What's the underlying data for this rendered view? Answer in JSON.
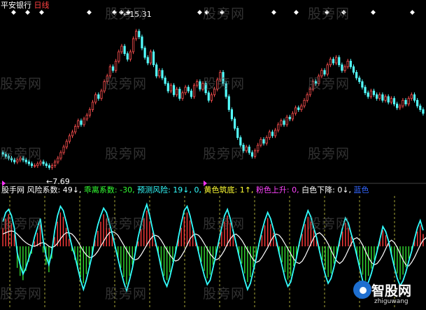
{
  "header": {
    "stock_name": "平安银行",
    "period": "日线",
    "colors": {
      "stock_name": "#ffffff",
      "period": "#ff4040"
    }
  },
  "price_panel": {
    "high_label": "15.31",
    "low_label": "7.69",
    "marker_symbol": "◆"
  },
  "indicator_row": {
    "items": [
      {
        "text": "股手网",
        "color": "#ffffff"
      },
      {
        "text": "风险系数: 49↓,",
        "color": "#ffffff"
      },
      {
        "text": "乖离系数: -30,",
        "color": "#33ff33"
      },
      {
        "text": "预测风险: 19↓, 0,",
        "color": "#33ffff"
      },
      {
        "text": "黄色筑底: 1↑,",
        "color": "#ffff33"
      },
      {
        "text": "粉色上升: 0,",
        "color": "#ff44ff"
      },
      {
        "text": "白色下降: 0↓,",
        "color": "#ffffff"
      },
      {
        "text": "蓝色",
        "color": "#3366ff"
      }
    ]
  },
  "watermark": {
    "text": "股旁网"
  },
  "logo": {
    "name": "智股网",
    "url": "zhiguwang"
  },
  "chart_data": [
    {
      "type": "candlestick",
      "title": "平安银行 日线",
      "ylim": [
        7.0,
        16.0
      ],
      "annotations": {
        "high": 15.31,
        "low": 7.69
      },
      "close": [
        8.4,
        8.3,
        8.2,
        8.1,
        8.0,
        8.1,
        8.2,
        8.1,
        8.0,
        7.9,
        7.8,
        7.8,
        7.9,
        8.0,
        7.9,
        7.8,
        7.7,
        7.8,
        8.0,
        8.2,
        8.5,
        8.8,
        9.1,
        9.4,
        9.6,
        9.9,
        10.2,
        10.0,
        10.3,
        10.5,
        10.8,
        11.2,
        11.6,
        11.4,
        11.8,
        12.3,
        12.6,
        13.1,
        12.9,
        13.4,
        13.9,
        14.2,
        13.8,
        13.5,
        13.9,
        14.6,
        15.0,
        14.7,
        14.1,
        13.6,
        13.3,
        13.9,
        13.2,
        12.6,
        12.9,
        12.5,
        12.2,
        11.8,
        12.1,
        11.6,
        11.9,
        11.4,
        11.7,
        12.0,
        11.8,
        11.5,
        12.1,
        12.3,
        11.9,
        12.2,
        11.7,
        11.3,
        11.6,
        11.9,
        12.4,
        12.8,
        12.2,
        11.5,
        10.8,
        10.3,
        9.8,
        9.3,
        8.9,
        8.6,
        8.8,
        8.5,
        8.3,
        8.6,
        8.9,
        9.2,
        9.0,
        9.3,
        9.6,
        9.4,
        9.7,
        10.0,
        10.2,
        10.0,
        10.4,
        10.3,
        10.6,
        10.9,
        10.8,
        11.0,
        11.3,
        11.6,
        11.9,
        12.3,
        12.2,
        12.6,
        12.9,
        12.7,
        13.2,
        13.5,
        13.3,
        13.6,
        13.2,
        12.9,
        13.1,
        13.4,
        13.1,
        12.8,
        12.5,
        12.3,
        12.0,
        11.7,
        11.5,
        11.8,
        11.6,
        11.4,
        11.6,
        11.3,
        11.5,
        11.2,
        11.4,
        11.1,
        10.9,
        11.0,
        11.3,
        11.1,
        11.4,
        11.6,
        11.3,
        11.0,
        10.8,
        10.6
      ],
      "open": [
        8.5,
        8.4,
        8.3,
        8.2,
        8.1,
        8.0,
        8.1,
        8.2,
        8.1,
        8.0,
        7.9,
        7.8,
        7.8,
        7.9,
        8.0,
        7.9,
        7.8,
        7.7,
        7.8,
        8.0,
        8.2,
        8.5,
        8.8,
        9.1,
        9.4,
        9.6,
        9.9,
        10.2,
        10.0,
        10.3,
        10.5,
        10.8,
        11.2,
        11.6,
        11.4,
        11.8,
        12.3,
        12.6,
        13.1,
        12.9,
        13.4,
        13.9,
        14.2,
        13.8,
        13.5,
        13.9,
        14.6,
        15.0,
        14.7,
        14.1,
        13.6,
        13.3,
        13.9,
        13.2,
        12.6,
        12.9,
        12.5,
        12.2,
        11.8,
        12.1,
        11.6,
        11.9,
        11.4,
        11.7,
        12.0,
        11.8,
        11.5,
        12.1,
        12.3,
        11.9,
        12.2,
        11.7,
        11.3,
        11.6,
        11.9,
        12.4,
        12.8,
        12.2,
        11.5,
        10.8,
        10.3,
        9.8,
        9.3,
        8.9,
        8.6,
        8.8,
        8.5,
        8.3,
        8.6,
        8.9,
        9.2,
        9.0,
        9.3,
        9.6,
        9.4,
        9.7,
        10.0,
        10.2,
        10.0,
        10.4,
        10.3,
        10.6,
        10.9,
        10.8,
        11.0,
        11.3,
        11.6,
        11.9,
        12.3,
        12.2,
        12.6,
        12.9,
        12.7,
        13.2,
        13.5,
        13.3,
        13.6,
        13.2,
        12.9,
        13.1,
        13.4,
        13.1,
        12.8,
        12.5,
        12.3,
        12.0,
        11.7,
        11.5,
        11.8,
        11.6,
        11.4,
        11.6,
        11.3,
        11.5,
        11.2,
        11.4,
        11.1,
        10.9,
        11.0,
        11.3,
        11.1,
        11.4,
        11.6,
        11.3,
        11.0,
        10.8
      ]
    },
    {
      "type": "bar",
      "title": "股手网 风险系数",
      "ylim": [
        -100,
        100
      ],
      "values": [
        30,
        45,
        52,
        38,
        20,
        -35,
        -48,
        -55,
        -40,
        -25,
        -12,
        8,
        22,
        35,
        -10,
        -30,
        -42,
        -20,
        15,
        40,
        55,
        48,
        30,
        12,
        -8,
        -22,
        -38,
        -50,
        -60,
        -45,
        -30,
        -15,
        10,
        25,
        40,
        52,
        45,
        30,
        18,
        -5,
        -20,
        -35,
        -50,
        -62,
        -48,
        -30,
        -12,
        8,
        28,
        45,
        58,
        40,
        22,
        5,
        -15,
        -32,
        -48,
        -55,
        -42,
        -25,
        -10,
        12,
        30,
        48,
        55,
        42,
        26,
        10,
        -8,
        -25,
        -40,
        -52,
        -46,
        -30,
        -14,
        6,
        24,
        40,
        50,
        38,
        20,
        4,
        -12,
        -28,
        -44,
        -58,
        -50,
        -34,
        -18,
        2,
        18,
        34,
        46,
        36,
        22,
        8,
        -10,
        -26,
        -42,
        -54,
        -48,
        -32,
        -16,
        4,
        20,
        36,
        48,
        40,
        26,
        12,
        -6,
        -22,
        -38,
        -50,
        -44,
        -28,
        -12,
        8,
        24,
        38,
        30,
        16,
        2,
        -14,
        -30,
        -46,
        -56,
        -48,
        -36,
        -22,
        -8,
        10,
        26,
        18,
        4,
        -12,
        -28,
        -44,
        -54,
        -46,
        -34,
        -20,
        -6,
        10,
        24,
        34,
        20
      ],
      "lines": {
        "cyan": [
          40,
          55,
          60,
          50,
          30,
          -10,
          -30,
          -45,
          -35,
          -20,
          -5,
          15,
          30,
          45,
          10,
          -15,
          -30,
          -10,
          25,
          50,
          65,
          58,
          40,
          20,
          0,
          -15,
          -35,
          -55,
          -70,
          -55,
          -35,
          -15,
          15,
          35,
          50,
          62,
          55,
          38,
          20,
          0,
          -20,
          -40,
          -58,
          -72,
          -55,
          -35,
          -10,
          15,
          35,
          55,
          68,
          50,
          28,
          8,
          -12,
          -35,
          -55,
          -65,
          -50,
          -30,
          -10,
          15,
          38,
          58,
          65,
          50,
          30,
          10,
          -10,
          -30,
          -48,
          -62,
          -55,
          -35,
          -15,
          8,
          30,
          50,
          60,
          45,
          25,
          5,
          -15,
          -35,
          -55,
          -70,
          -60,
          -40,
          -20,
          5,
          25,
          42,
          55,
          45,
          28,
          10,
          -12,
          -32,
          -52,
          -65,
          -58,
          -38,
          -18,
          6,
          26,
          44,
          58,
          48,
          30,
          14,
          -8,
          -28,
          -46,
          -60,
          -52,
          -34,
          -14,
          10,
          30,
          46,
          38,
          20,
          4,
          -16,
          -36,
          -56,
          -68,
          -58,
          -44,
          -26,
          -8,
          12,
          32,
          24,
          8,
          -14,
          -34,
          -52,
          -64,
          -56,
          -42,
          -24,
          -8,
          12,
          30,
          42,
          26
        ],
        "white": [
          20,
          22,
          24,
          25,
          24,
          20,
          15,
          10,
          6,
          3,
          1,
          0,
          2,
          5,
          6,
          4,
          0,
          -2,
          0,
          5,
          12,
          18,
          22,
          22,
          20,
          15,
          8,
          0,
          -8,
          -14,
          -18,
          -18,
          -14,
          -8,
          0,
          8,
          16,
          22,
          24,
          22,
          18,
          10,
          2,
          -6,
          -14,
          -20,
          -22,
          -20,
          -14,
          -6,
          2,
          10,
          16,
          18,
          16,
          10,
          2,
          -6,
          -14,
          -20,
          -24,
          -22,
          -16,
          -8,
          2,
          12,
          18,
          20,
          18,
          12,
          4,
          -4,
          -12,
          -18,
          -22,
          -20,
          -14,
          -6,
          4,
          12,
          18,
          20,
          16,
          10,
          2,
          -6,
          -14,
          -22,
          -26,
          -24,
          -18,
          -10,
          -2,
          8,
          16,
          20,
          18,
          12,
          4,
          -4,
          -12,
          -20,
          -26,
          -28,
          -24,
          -16,
          -6,
          4,
          14,
          20,
          22,
          18,
          12,
          4,
          -6,
          -16,
          -24,
          -28,
          -24,
          -16,
          -6,
          4,
          12,
          14,
          10,
          2,
          -8,
          -18,
          -26,
          -30,
          -28,
          -22,
          -14,
          -4,
          6,
          10,
          6,
          -2,
          -12,
          -22,
          -30,
          -32,
          -26,
          -18,
          -8,
          2,
          10,
          14,
          10
        ]
      }
    }
  ]
}
